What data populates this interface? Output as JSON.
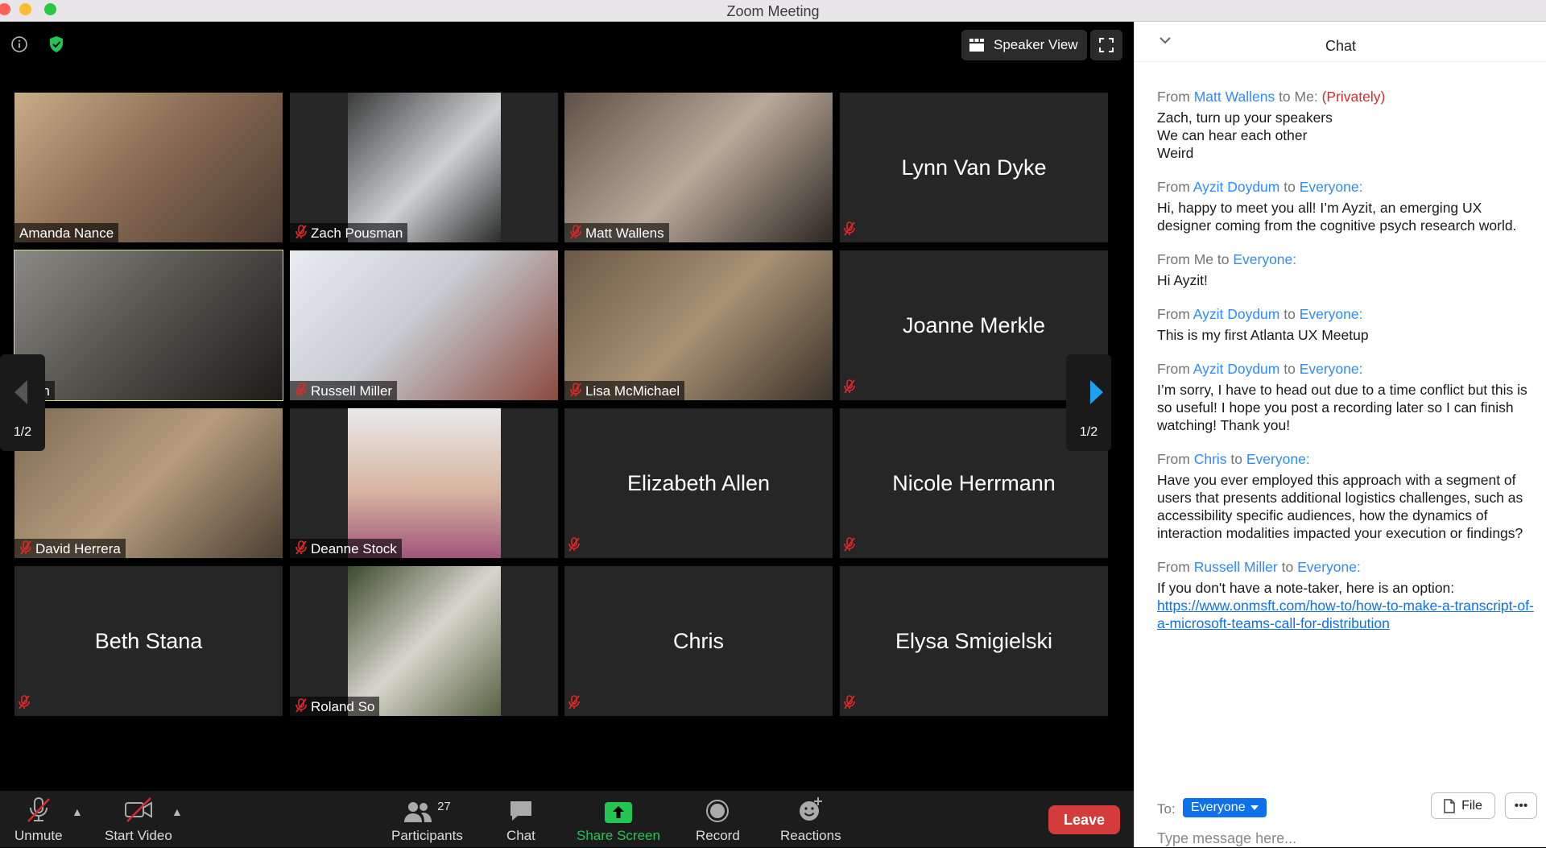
{
  "window": {
    "title": "Zoom Meeting"
  },
  "top_controls": {
    "speaker_view_label": "Speaker View"
  },
  "participants_grid": {
    "page_indicator_left": "1/2",
    "page_indicator_right": "1/2",
    "tiles": [
      {
        "name": "Amanda Nance",
        "video": true,
        "muted": false
      },
      {
        "name": "Zach Pousman",
        "video": true,
        "muted": true
      },
      {
        "name": "Matt Wallens",
        "video": true,
        "muted": true
      },
      {
        "name": "Lynn Van Dyke",
        "video": false,
        "muted": true
      },
      {
        "name": "Allen",
        "video": true,
        "muted": false,
        "active_speaker": true
      },
      {
        "name": "Russell Miller",
        "video": true,
        "muted": true
      },
      {
        "name": "Lisa McMichael",
        "video": true,
        "muted": true
      },
      {
        "name": "Joanne Merkle",
        "video": false,
        "muted": true
      },
      {
        "name": "David Herrera",
        "video": true,
        "muted": true
      },
      {
        "name": "Deanne Stock",
        "video": true,
        "muted": true
      },
      {
        "name": "Elizabeth Allen",
        "video": false,
        "muted": true
      },
      {
        "name": "Nicole Herrmann",
        "video": false,
        "muted": true
      },
      {
        "name": "Beth Stana",
        "video": false,
        "muted": true
      },
      {
        "name": "Roland So",
        "video": true,
        "muted": true
      },
      {
        "name": "Chris",
        "video": false,
        "muted": true
      },
      {
        "name": "Elysa Smigielski",
        "video": false,
        "muted": true
      }
    ]
  },
  "toolbar": {
    "unmute_label": "Unmute",
    "start_video_label": "Start Video",
    "participants_label": "Participants",
    "participants_count": "27",
    "chat_label": "Chat",
    "share_screen_label": "Share Screen",
    "record_label": "Record",
    "reactions_label": "Reactions",
    "leave_label": "Leave"
  },
  "chat": {
    "title": "Chat",
    "messages": [
      {
        "from": "Matt Wallens",
        "to": "Me:",
        "private": "(Privately)",
        "lines": [
          "Zach, turn up your speakers",
          "We can hear each other",
          "Weird"
        ]
      },
      {
        "from": "Ayzit Doydum",
        "to": "Everyone:",
        "lines": [
          "Hi, happy to meet you all! I’m Ayzit, an emerging UX designer coming from the cognitive psych research world."
        ]
      },
      {
        "from": "Me",
        "to": "Everyone:",
        "lines": [
          "Hi Ayzit!"
        ]
      },
      {
        "from": "Ayzit Doydum",
        "to": "Everyone:",
        "lines": [
          "This is my first Atlanta UX Meetup"
        ]
      },
      {
        "from": "Ayzit Doydum",
        "to": "Everyone:",
        "lines": [
          "I’m sorry, I have to head out due to a time conflict but this is so useful! I hope you post a recording later so I can finish watching!  Thank you!"
        ]
      },
      {
        "from": "Chris",
        "to": "Everyone:",
        "lines": [
          "Have you ever employed this approach with a segment of users that presents additional logistics challenges, such as accessibility specific audiences, how the dynamics of interaction modalities impacted your execution or findings?"
        ]
      },
      {
        "from": "Russell Miller",
        "to": "Everyone:",
        "lines": [
          "If you don't have a note-taker, here is an option:"
        ],
        "link": "https://www.onmsft.com/how-to/how-to-make-a-transcript-of-a-microsoft-teams-call-for-distribution"
      }
    ],
    "from_word": "From",
    "to_word": "to",
    "footer": {
      "to_label": "To:",
      "recipient": "Everyone",
      "file_label": "File",
      "placeholder": "Type message here..."
    }
  }
}
